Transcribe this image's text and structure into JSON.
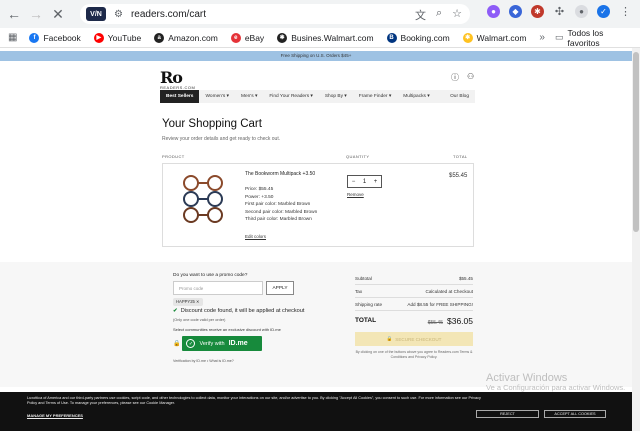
{
  "browser": {
    "url": "readers.com/cart",
    "site_badge": "V/N",
    "bookmarks": [
      {
        "label": "Facebook",
        "icon": "facebook-icon",
        "color": "#1877f2",
        "glyph": "f"
      },
      {
        "label": "YouTube",
        "icon": "youtube-icon",
        "color": "#ff0000",
        "glyph": "▶"
      },
      {
        "label": "Amazon.com",
        "icon": "amazon-icon",
        "color": "#222222",
        "glyph": "a"
      },
      {
        "label": "eBay",
        "icon": "ebay-icon",
        "color": "#e53238",
        "glyph": "e"
      },
      {
        "label": "Busines.Walmart.com",
        "icon": "walmart-business-icon",
        "color": "#222222",
        "glyph": "✱"
      },
      {
        "label": "Booking.com",
        "icon": "booking-icon",
        "color": "#003580",
        "glyph": "B"
      },
      {
        "label": "Walmart.com",
        "icon": "walmart-icon",
        "color": "#ffc220",
        "glyph": "✱"
      }
    ],
    "all_bookmarks": "Todos los favoritos"
  },
  "site": {
    "promo_strip": "Free Shipping on U.S. Orders $45+",
    "logo_main": "Ro",
    "logo_sub": "READERS.COM",
    "nav": [
      "Best Sellers",
      "Women's ▾",
      "Men's ▾",
      "Find Your Readers ▾",
      "Shop By ▾",
      "Frame Finder ▾",
      "Multipacks ▾",
      "Our Blog"
    ]
  },
  "cart": {
    "title": "Your Shopping Cart",
    "subtitle": "Review your order details and get ready to check out.",
    "col_product": "PRODUCT",
    "col_quantity": "QUANTITY",
    "col_total": "TOTAL",
    "item": {
      "name": "The Bookworm Multipack +3.50",
      "lines": [
        "Price: $55.45",
        "Power: +3.50",
        "First pair color: Marbled Brown",
        "Second pair color: Marbled Brown",
        "Third pair color: Marbled Brown"
      ],
      "edit": "Edit colors",
      "qty": "1",
      "minus": "−",
      "plus": "+",
      "remove": "Remove",
      "total": "$55.45"
    }
  },
  "promo": {
    "question": "Do you want to use a promo code?",
    "placeholder": "Promo code",
    "apply": "APPLY",
    "chip": "HAPPY25 ✕",
    "found": "Discount code found, it will be applied at checkout",
    "one_code": "(Only one code valid per order)",
    "exclusive": "Select communities receive an exclusive discount with ID.me",
    "verify": "Verify with",
    "idme": "ID.me",
    "verif_note": "Verification by ID.me • What is ID.me?"
  },
  "summary": {
    "subtotal_label": "Subtotal",
    "subtotal": "$55.45",
    "tax_label": "Tax",
    "tax": "Calculated at Checkout",
    "shipping_label": "Shipping rate",
    "shipping": "Add $8.55 for FREE SHIPPING!",
    "total_label": "TOTAL",
    "old_total": "$55.45",
    "total": "$36.05",
    "checkout": "SECURE CHECKOUT",
    "agree": "By clicking on one of the buttons above you agree to Readers.com Terms & Conditions and Privacy Policy."
  },
  "cookie": {
    "text": "Luxottica of America and our third-party partners use cookies, script code, and other technologies to collect data, monitor your interactions on our site, and/or advertise to you. By clicking \"Accept All Cookies\", you consent to such use. For more information see our Privacy Policy and Terms of Use. To manage your preferences, please see our Cookie Manager.",
    "manage": "MANAGE MY PREFERENCES",
    "reject": "REJECT",
    "accept": "ACCEPT ALL COOKIES"
  },
  "os_watermark": {
    "line1": "Activar Windows",
    "line2": "Ve a Configuración para activar Windows."
  }
}
